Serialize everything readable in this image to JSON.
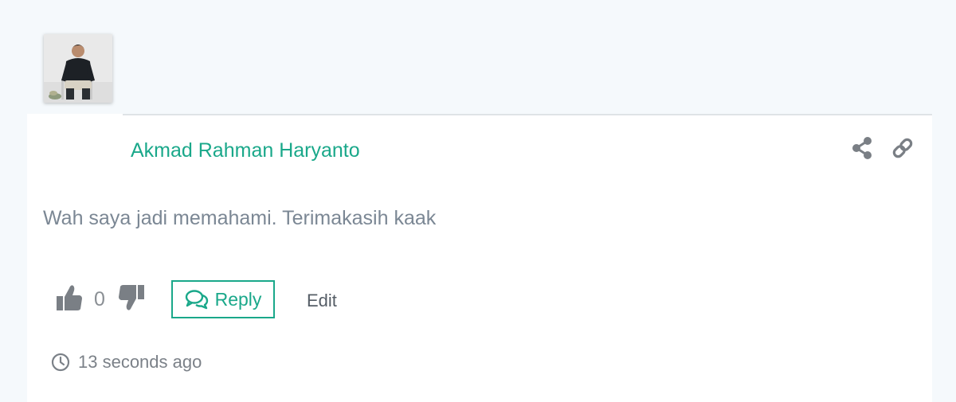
{
  "comment": {
    "author": "Akmad Rahman Haryanto",
    "text": "Wah saya jadi memahami. Terimakasih kaak",
    "votes": "0",
    "reply_label": "Reply",
    "edit_label": "Edit",
    "timestamp": "13 seconds ago"
  },
  "icons": {
    "share": "share-icon",
    "link": "link-icon",
    "like": "thumbs-up-icon",
    "dislike": "thumbs-down-icon",
    "reply": "comments-icon",
    "time": "clock-icon"
  },
  "colors": {
    "accent": "#1aa88a",
    "text_muted": "#7b8794",
    "icon_gray": "#7a7f85",
    "page_bg": "#f5f9fc"
  }
}
